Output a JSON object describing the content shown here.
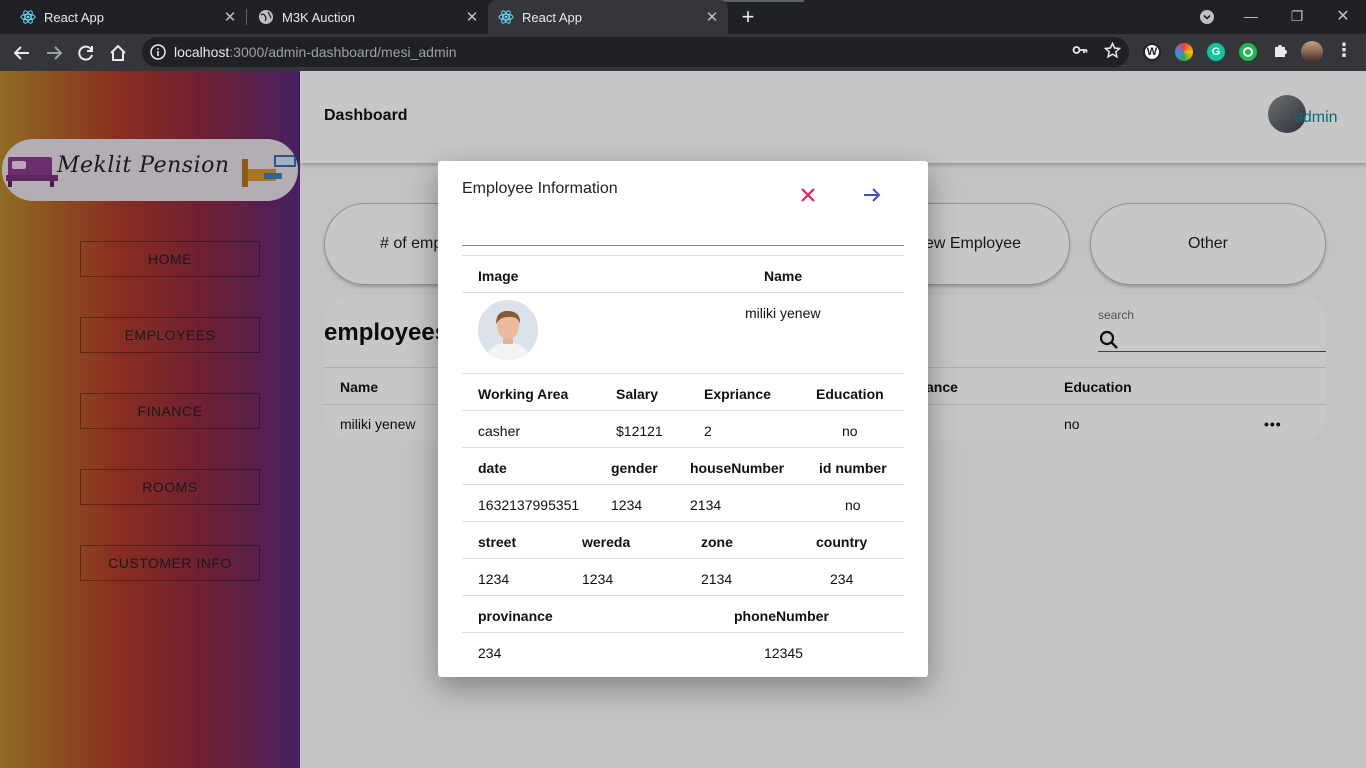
{
  "browser": {
    "tabs": [
      {
        "title": "React App",
        "icon": "react-icon"
      },
      {
        "title": "M3K Auction",
        "icon": "globe-icon"
      },
      {
        "title": "React App",
        "icon": "react-icon"
      }
    ],
    "url_host": "localhost",
    "url_rest": ":3000/admin-dashboard/mesi_admin"
  },
  "sidebar": {
    "logo_text": "Meklit Pension",
    "items": [
      {
        "label": "HOME"
      },
      {
        "label": "EMPLOYEES"
      },
      {
        "label": "FINANCE"
      },
      {
        "label": "ROOMS"
      },
      {
        "label": "CUSTOMER INFO"
      }
    ]
  },
  "header": {
    "title": "Dashboard",
    "user": "admin"
  },
  "cards": [
    "# of emp",
    "ew Employee",
    "Other"
  ],
  "employees": {
    "heading": "employees",
    "search_label": "search",
    "columns": [
      "Name",
      "ance",
      "Education"
    ],
    "row": {
      "name": "miliki yenew",
      "education": "no"
    }
  },
  "modal": {
    "title": "Employee Information",
    "headers1": [
      "Image",
      "Name"
    ],
    "name": "miliki yenew",
    "headers2": [
      "Working Area",
      "Salary",
      "Expriance",
      "Education"
    ],
    "row2": [
      "casher",
      "$12121",
      "2",
      "no"
    ],
    "headers3": [
      "date",
      "gender",
      "houseNumber",
      "id number"
    ],
    "row3": [
      "1632137995351",
      "1234",
      "2134",
      "no"
    ],
    "headers4": [
      "street",
      "wereda",
      "zone",
      "country"
    ],
    "row4": [
      "1234",
      "1234",
      "2134",
      "234"
    ],
    "headers5": [
      "provinance",
      "phoneNumber"
    ],
    "row5": [
      "234",
      "12345"
    ]
  },
  "colors": {
    "close": "#e0245e",
    "next": "#3f51b5",
    "admin_text": "#0c8a9b"
  }
}
